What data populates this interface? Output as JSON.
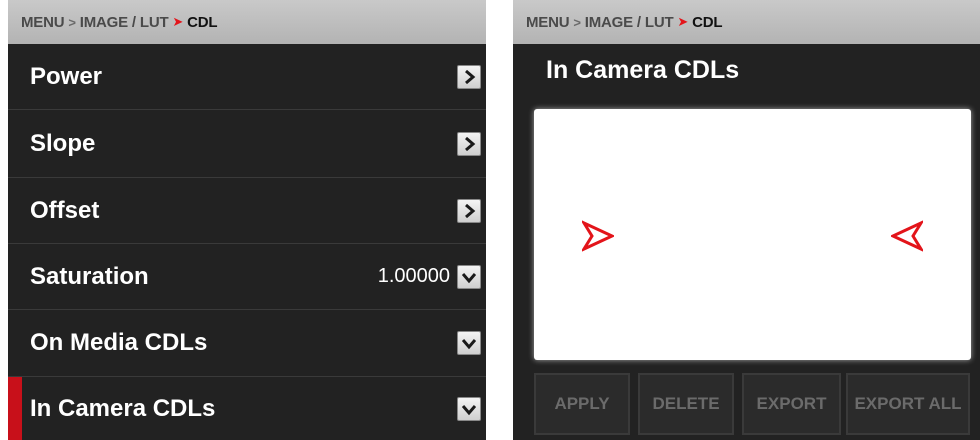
{
  "left_panel": {
    "breadcrumb": {
      "part1": "MENU",
      "part2": "IMAGE / LUT",
      "current": "CDL"
    },
    "rows": [
      {
        "label": "Power",
        "value": ""
      },
      {
        "label": "Slope",
        "value": ""
      },
      {
        "label": "Offset",
        "value": ""
      },
      {
        "label": "Saturation",
        "value": "1.00000"
      },
      {
        "label": "On Media CDLs",
        "value": ""
      },
      {
        "label": "In Camera CDLs",
        "value": ""
      }
    ]
  },
  "right_panel": {
    "breadcrumb": {
      "part1": "MENU",
      "part2": "IMAGE / LUT",
      "current": "CDL"
    },
    "title": "In Camera CDLs",
    "buttons": {
      "apply": "APPLY",
      "delete": "DELETE",
      "export": "EXPORT",
      "export_all": "EXPORT ALL"
    }
  },
  "colors": {
    "panel_bg": "#222222",
    "breadcrumb_bg": "#c1c1c1",
    "accent_red": "#e3141a",
    "active_marker": "#c8101a",
    "button_disabled_text": "#6b6b6b"
  },
  "icons": {
    "row_expand": "chevron-right-icon",
    "row_dropdown": "chevron-down-icon",
    "list_indicators": [
      "red-caret-right-icon",
      "red-caret-left-icon"
    ]
  }
}
